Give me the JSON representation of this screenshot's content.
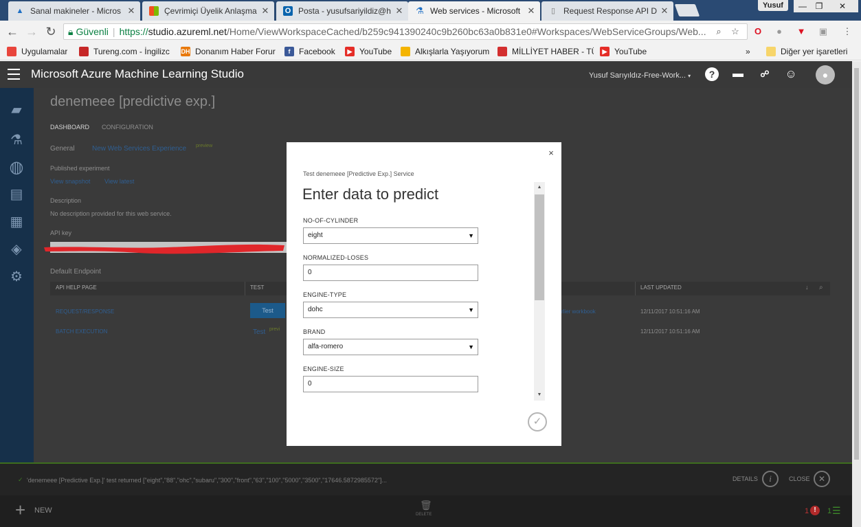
{
  "browser": {
    "tabs": [
      {
        "title": "Sanal makineler - Micros",
        "active": false,
        "icon": "azure-icon"
      },
      {
        "title": "Çevrimiçi Üyelik Anlaşma",
        "active": false,
        "icon": "microsoft-icon"
      },
      {
        "title": "Posta - yusufsariyildiz@h",
        "active": false,
        "icon": "outlook-icon"
      },
      {
        "title": "Web services - Microsoft",
        "active": true,
        "icon": "flask-icon"
      },
      {
        "title": "Request Response API D",
        "active": false,
        "icon": "document-icon"
      }
    ],
    "profile": "Yusuf",
    "address": {
      "secure_label": "Güvenli",
      "scheme": "https://",
      "host": "studio.azureml.net",
      "path": "/Home/ViewWorkspaceCached/b259c941390240c9b260bc63a0b831e0#Workspaces/WebServiceGroups/Web..."
    },
    "bookmarks": [
      {
        "label": "Uygulamalar",
        "icon": "apps-grid-icon",
        "color": "#e8453c"
      },
      {
        "label": "Tureng.com - İngilizc",
        "icon": "tureng-icon",
        "color": "#c62828"
      },
      {
        "label": "Donanım Haber Forur",
        "icon": "dh-icon",
        "color": "#e8790c"
      },
      {
        "label": "Facebook",
        "icon": "facebook-icon",
        "color": "#3b5998"
      },
      {
        "label": "YouTube",
        "icon": "youtube-icon",
        "color": "#e52d27"
      },
      {
        "label": "Alkışlarla Yaşıyorum",
        "icon": "alkis-icon",
        "color": "#f4b400"
      },
      {
        "label": "MİLLİYET HABER - TÜ",
        "icon": "milliyet-icon",
        "color": "#d32f2f"
      },
      {
        "label": "YouTube",
        "icon": "youtube-icon",
        "color": "#e52d27"
      }
    ],
    "bookmarks_more": "»",
    "other_bookmarks": "Diğer yer işaretleri"
  },
  "app": {
    "title": "Microsoft Azure Machine Learning Studio",
    "workspace": "Yusuf Sarıyıldız-Free-Work...",
    "page_title": "denemeee [predictive exp.]",
    "tabs": [
      "DASHBOARD",
      "CONFIGURATION"
    ],
    "general_label": "General",
    "new_experience_link": "New Web Services Experience",
    "new_experience_badge": "preview",
    "published_label": "Published experiment",
    "view_snapshot": "View snapshot",
    "view_latest": "View latest",
    "description_label": "Description",
    "description_text": "No description provided for this web service.",
    "api_key_label": "API key",
    "default_endpoint": "Default Endpoint",
    "table": {
      "headers": [
        "API HELP PAGE",
        "TEST",
        "LAST UPDATED"
      ],
      "rows": [
        {
          "name": "REQUEST/RESPONSE",
          "test": "Test",
          "extra": "rlier workbook",
          "updated": "12/11/2017 10:51:16 AM"
        },
        {
          "name": "BATCH EXECUTION",
          "test": "Test",
          "test_badge": "previ",
          "updated": "12/11/2017 10:51:16 AM"
        }
      ]
    },
    "status_message": "'denemeee [Predictive Exp.]' test returned [\"eight\",\"88\",\"ohc\",\"subaru\",\"300\",\"front\",\"63\",\"100\",\"5000\",\"3500\",\"17646.5872985572\"]...",
    "details_label": "DETAILS",
    "close_label": "CLOSE",
    "new_label": "NEW",
    "delete_label": "DELETE",
    "counter_alerts": "1",
    "counter_tasks": "1"
  },
  "modal": {
    "subtitle": "Test denemeee [Predictive Exp.] Service",
    "heading": "Enter data to predict",
    "fields": [
      {
        "label": "NO-OF-CYLINDER",
        "value": "eight",
        "type": "select"
      },
      {
        "label": "NORMALIZED-LOSES",
        "value": "0",
        "type": "input"
      },
      {
        "label": "ENGINE-TYPE",
        "value": "dohc",
        "type": "select"
      },
      {
        "label": "BRAND",
        "value": "alfa-romero",
        "type": "select"
      },
      {
        "label": "ENGINE-SIZE",
        "value": "0",
        "type": "input"
      }
    ],
    "close_glyph": "×",
    "ok_glyph": "✓"
  }
}
